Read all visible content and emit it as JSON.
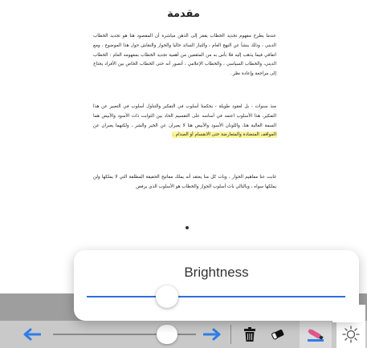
{
  "document": {
    "title": "مقدمة",
    "paragraphs": [
      "عندما يطرح مفهوم تجديد الخطاب يقفز إلى الذهن مباشرة أن المقصود هنا هو تجديد الخطاب الديني ، وذلك ينشأ عن النهج العام ، والتيار السائد حاليا والحوار والنقاش حول هذا الموضوع ، ومع اتفاقي فيما يذهب إليه فلا بأس به من المثقفين من أهمية تجديد الخطاب بمفهومه العام : الخطاب الديني، والخطاب السياسي ، والخطاب الإعلامي ، أتصور أنه حتى الخطاب الخاص بين الأفراد يحتاج إلى مراجعة وإعادة نظر .",
      "منذ سنوات - بل لعقود طويلة - يحكمنا أسلوب في التفكير والتناول أسلوب في التعبير عن هذا التفكير، هذا الأسلوب اعتمد في أساسه على التقسيم الحاد بين الثوابت ذات الأسود والأبيض هما السمة الغالبة هنا، واللونان الأسود والأبيض هنا لا يعبران عن الخير والشر ، ولكنهما يعبران عن",
      "غابت عنا مفاهيم الحوار ، وبات كل منا يعتقد أنه يملك مفاتيح الحقيقة المطلقة التي لا يملكها ولن يملكها سواه ، وبالتالي بات أسلوب الحوار والخطاب هو الأسلوب الذي يرفض"
    ],
    "highlighted_text": "المواقف المتضادة والمتعارضة حتى الانقسام أو الصدام ."
  },
  "brightness_popover": {
    "title": "Brightness",
    "level": 0.31
  },
  "toolbar": {
    "page_slider_level": 0.85,
    "icons": [
      "arrow-left-icon",
      "arrow-right-icon",
      "trash-icon",
      "eraser-icon",
      "highlighter-icon",
      "brightness-icon"
    ]
  },
  "colors": {
    "accent": "#2f6fe0",
    "toolbar_bg": "#c9c9c9",
    "highlight": "#fbf59a",
    "highlighter_pink": "#e4578f"
  }
}
